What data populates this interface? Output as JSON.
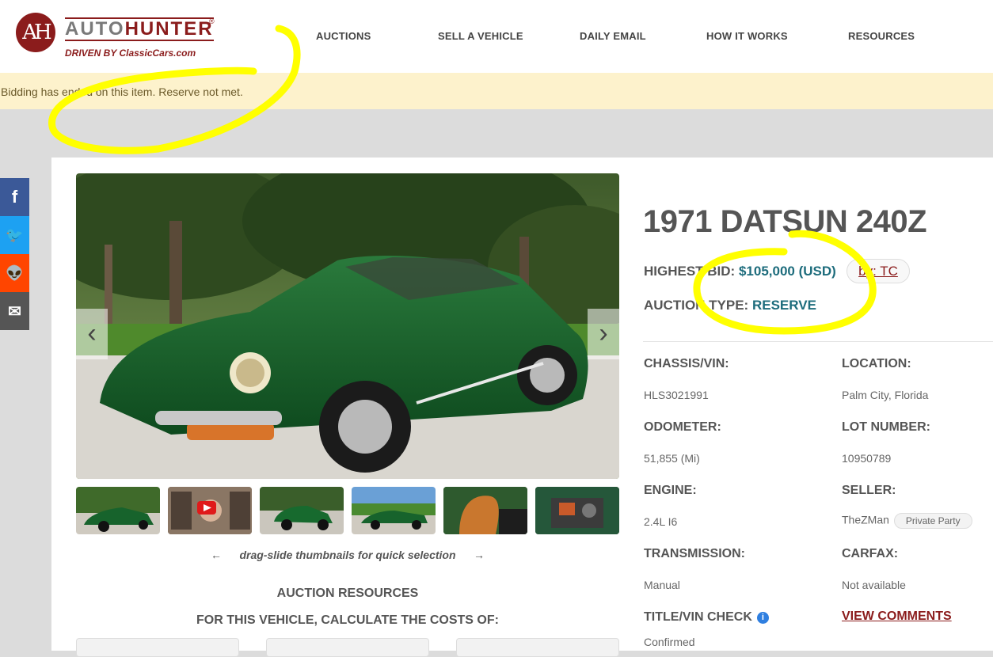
{
  "brand": {
    "logo_letters": "AH",
    "name_part1": "AUTO",
    "name_part2": "HUNTER",
    "registered": "®",
    "tagline": "DRIVEN BY ClassicCars.com"
  },
  "nav": {
    "items": [
      {
        "label": "AUCTIONS"
      },
      {
        "label": "SELL A VEHICLE"
      },
      {
        "label": "DAILY EMAIL"
      },
      {
        "label": "HOW IT WORKS"
      },
      {
        "label": "RESOURCES"
      }
    ]
  },
  "notice": "Bidding has ended on this item. Reserve not met.",
  "social": [
    {
      "name": "facebook-icon",
      "glyph": "f",
      "color": "#3b5998"
    },
    {
      "name": "twitter-icon",
      "glyph": "🐦",
      "color": "#1da1f2"
    },
    {
      "name": "reddit-icon",
      "glyph": "👽",
      "color": "#ff4500"
    },
    {
      "name": "email-icon",
      "glyph": "✉",
      "color": "#555555"
    }
  ],
  "gallery": {
    "prev_glyph": "‹",
    "next_glyph": "›",
    "thumbnail_count": 6,
    "hint": "drag-slide thumbnails for quick selection",
    "hint_left": "←",
    "hint_right": "→"
  },
  "resources": {
    "title": "AUCTION RESOURCES",
    "subtitle": "FOR THIS VEHICLE, CALCULATE THE COSTS OF:"
  },
  "listing": {
    "title": "1971 DATSUN 240Z",
    "highest_bid_label": "HIGHEST BID:",
    "highest_bid_value": "$105,000 (USD)",
    "bidder": "by: TC",
    "auction_type_label": "AUCTION TYPE:",
    "auction_type_value": "RESERVE"
  },
  "specs": {
    "chassis_label": "CHASSIS/VIN:",
    "chassis_value": "HLS3021991",
    "location_label": "LOCATION:",
    "location_value": "Palm City, Florida",
    "odometer_label": "ODOMETER:",
    "odometer_value": "51,855 (Mi)",
    "lot_label": "LOT NUMBER:",
    "lot_value": "10950789",
    "engine_label": "ENGINE:",
    "engine_value": "2.4L I6",
    "seller_label": "SELLER:",
    "seller_value": "TheZMan",
    "seller_type": "Private Party",
    "transmission_label": "TRANSMISSION:",
    "transmission_value": "Manual",
    "carfax_label": "CARFAX:",
    "carfax_value": "Not available",
    "title_check_label": "TITLE/VIN CHECK",
    "title_check_info": "i",
    "title_check_value": "Confirmed",
    "view_comments": "VIEW COMMENTS"
  },
  "colors": {
    "brand_red": "#8b1c1c",
    "bid_teal": "#1d6c7c",
    "notice_bg": "#fdf2cc",
    "highlight_yellow": "#ffff00"
  }
}
